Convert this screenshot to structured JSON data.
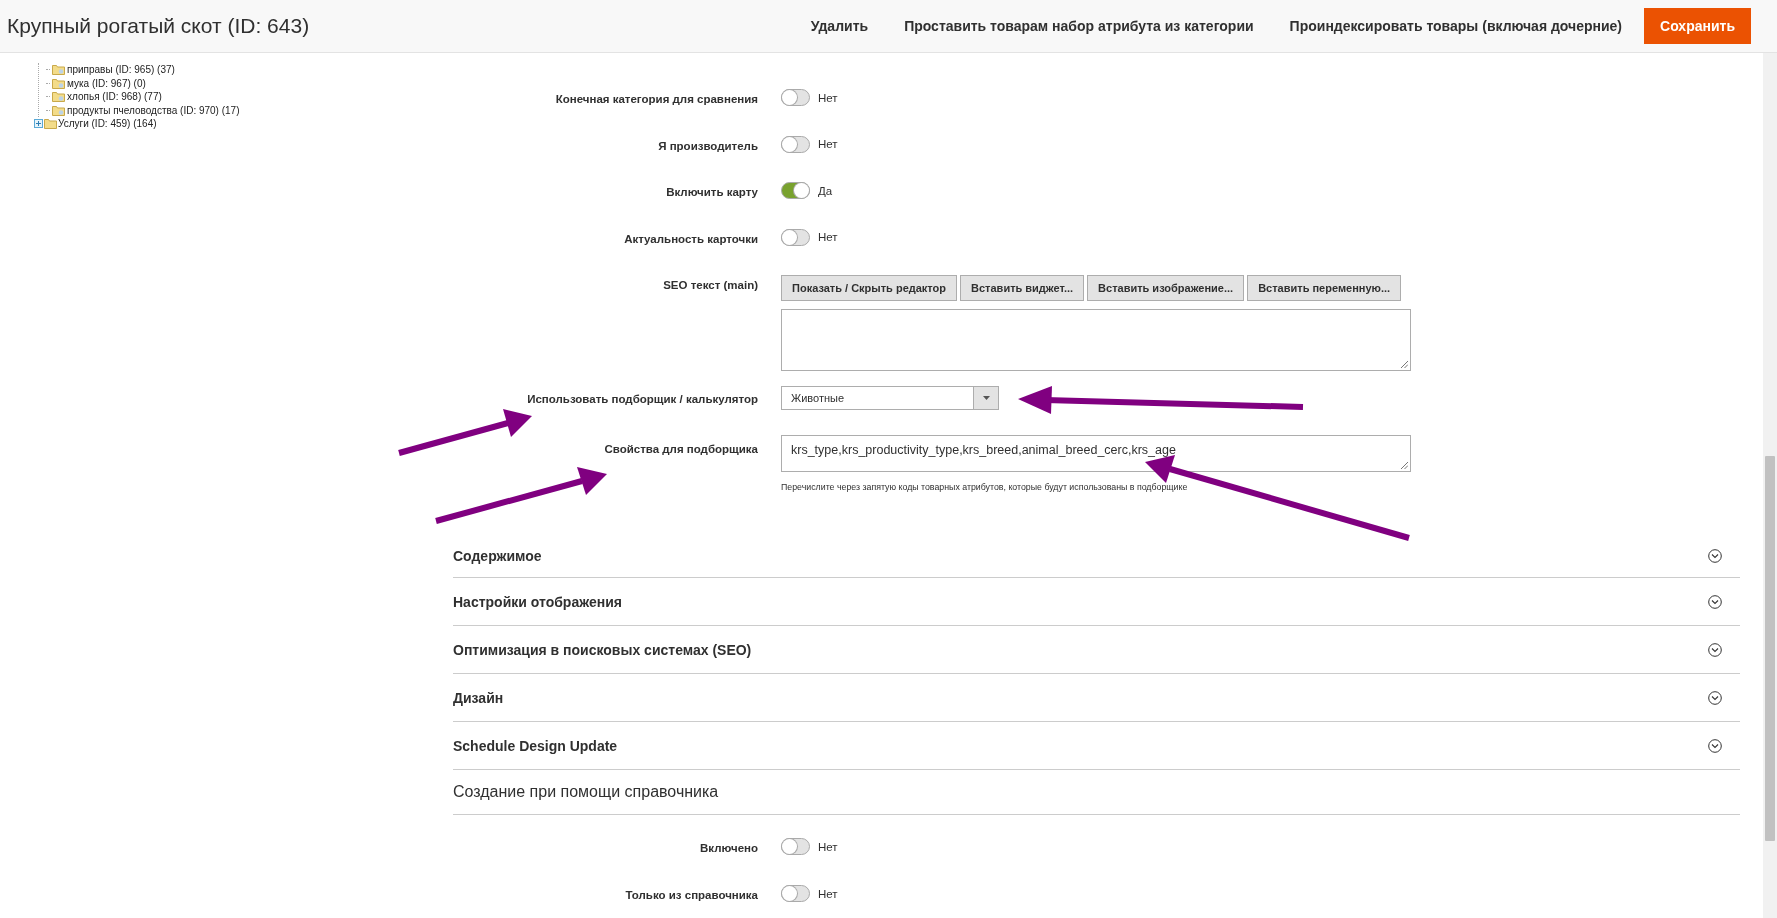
{
  "header": {
    "title": "Крупный рогатый скот (ID: 643)",
    "actions": [
      {
        "label": "Удалить",
        "kind": "link"
      },
      {
        "label": "Проставить товарам набор атрибута из категории",
        "kind": "link"
      },
      {
        "label": "Проиндексировать товары (включая дочерние)",
        "kind": "link"
      },
      {
        "label": "Сохранить",
        "kind": "primary"
      }
    ]
  },
  "tree": {
    "continued_children": [
      {
        "label": "приправы (ID: 965) (37)"
      },
      {
        "label": "мука (ID: 967) (0)"
      },
      {
        "label": "хлопья (ID: 968) (77)"
      },
      {
        "label": "продукты пчеловодства (ID: 970) (17)"
      }
    ],
    "items": [
      {
        "label": "Услуги (ID: 459) (164)",
        "expanded": false
      }
    ]
  },
  "fields": [
    {
      "kind": "toggle",
      "label": "Конечная категория для сравнения",
      "on": false,
      "value_text": "Нет"
    },
    {
      "kind": "toggle",
      "label": "Я производитель",
      "on": false,
      "value_text": "Нет"
    },
    {
      "kind": "toggle",
      "label": "Включить карту",
      "on": true,
      "value_text": "Да"
    },
    {
      "kind": "toggle",
      "label": "Актуальность карточки",
      "on": false,
      "value_text": "Нет"
    },
    {
      "kind": "editor",
      "label": "SEO текст (main)",
      "buttons": [
        "Показать / Скрыть редактор",
        "Вставить виджет...",
        "Вставить изображение...",
        "Вставить переменную..."
      ]
    },
    {
      "kind": "select",
      "label": "Использовать подборщик / калькулятор",
      "value": "Животные"
    },
    {
      "kind": "text",
      "label": "Свойства для подборщика",
      "value": "krs_type,krs_productivity_type,krs_breed,animal_breed_cerc,krs_age",
      "note": "Перечислите через запятую коды товарных атрибутов, которые будут использованы в подборщике"
    }
  ],
  "sections": [
    {
      "kind": "collapsible",
      "title": "Содержимое",
      "expanded": false
    },
    {
      "kind": "collapsible",
      "title": "Настройки отображения",
      "expanded": false
    },
    {
      "kind": "collapsible",
      "title": "Оптимизация в поисковых системах (SEO)",
      "expanded": false
    },
    {
      "kind": "collapsible",
      "title": "Дизайн",
      "expanded": false
    },
    {
      "kind": "collapsible",
      "title": "Schedule Design Update",
      "expanded": false
    },
    {
      "kind": "heading",
      "title": "Создание при помощи справочника"
    }
  ],
  "reference_fields": [
    {
      "kind": "toggle",
      "label": "Включено",
      "on": false,
      "value_text": "Нет"
    },
    {
      "kind": "toggle",
      "label": "Только из справочника",
      "on": false,
      "value_text": "Нет"
    }
  ]
}
